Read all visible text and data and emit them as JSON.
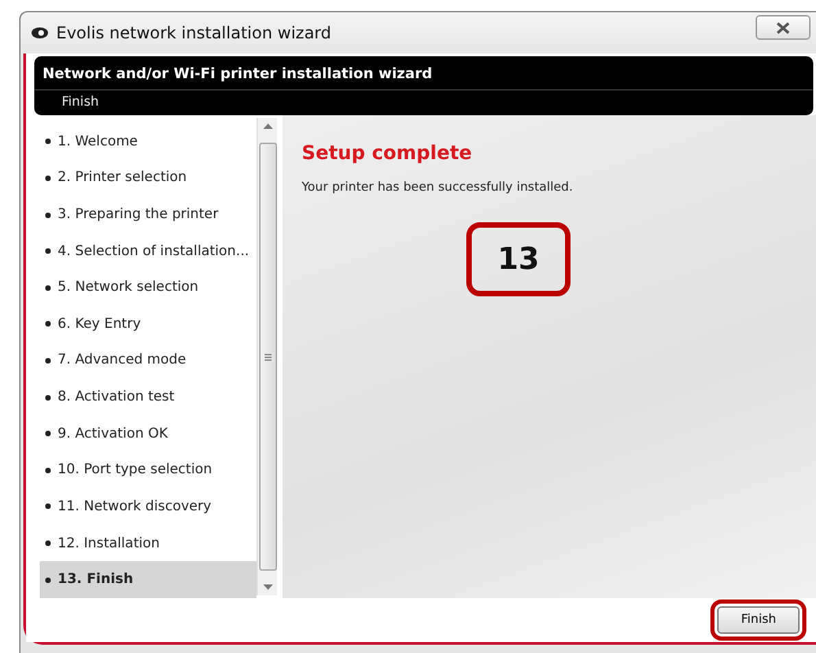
{
  "window": {
    "title": "Evolis network installation wizard"
  },
  "header": {
    "title": "Network and/or Wi-Fi printer installation wizard",
    "step": "Finish"
  },
  "steps": [
    {
      "label": "1. Welcome",
      "selected": false
    },
    {
      "label": "2. Printer selection",
      "selected": false
    },
    {
      "label": "3. Preparing the printer",
      "selected": false
    },
    {
      "label": "4. Selection of installation...",
      "selected": false
    },
    {
      "label": "5. Network selection",
      "selected": false
    },
    {
      "label": "6. Key Entry",
      "selected": false
    },
    {
      "label": "7. Advanced mode",
      "selected": false
    },
    {
      "label": "8. Activation test",
      "selected": false
    },
    {
      "label": "9. Activation OK",
      "selected": false
    },
    {
      "label": "10. Port type selection",
      "selected": false
    },
    {
      "label": "11. Network discovery",
      "selected": false
    },
    {
      "label": "12. Installation",
      "selected": false
    },
    {
      "label": "13. Finish",
      "selected": true
    }
  ],
  "content": {
    "heading": "Setup complete",
    "message": "Your printer has been successfully installed.",
    "callout": "13"
  },
  "buttons": [
    "Finish"
  ]
}
